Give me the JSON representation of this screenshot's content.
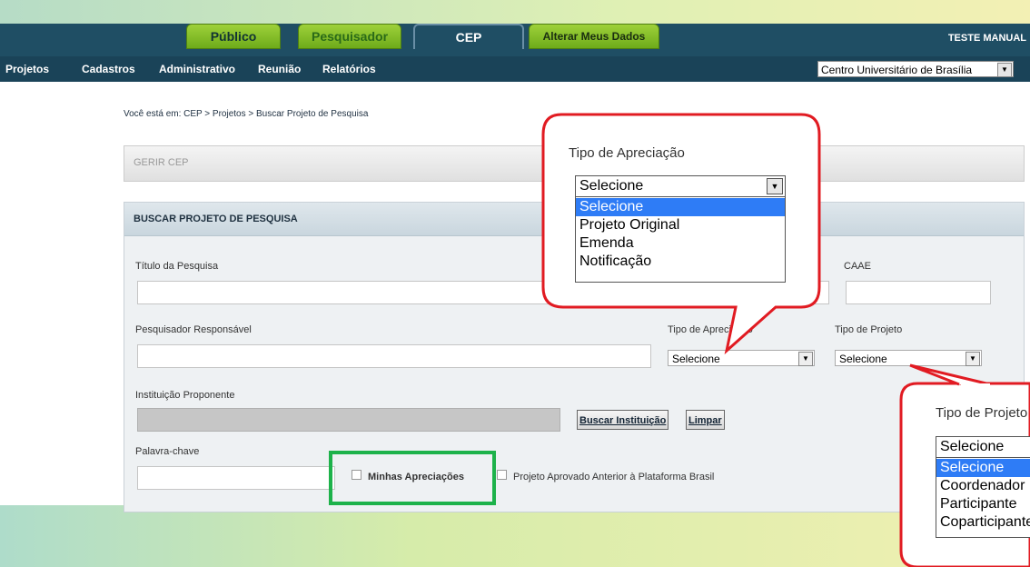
{
  "tabs": [
    {
      "label": "Público",
      "active": false
    },
    {
      "label": "Pesquisador",
      "active": false
    },
    {
      "label": "CEP",
      "active": true
    },
    {
      "label": "Alterar Meus Dados",
      "active": false
    }
  ],
  "user": {
    "name": "TESTE MANUAL"
  },
  "menu": [
    "Projetos",
    "Cadastros",
    "Administrativo",
    "Reunião",
    "Relatórios"
  ],
  "institution_select": {
    "value": "Centro Universitário de Brasília"
  },
  "breadcrumb": "Você está em: CEP > Projetos > Buscar Projeto de Pesquisa",
  "gerir_title": "GERIR CEP",
  "panel_title": "BUSCAR PROJETO DE PESQUISA",
  "form": {
    "titulo_label": "Título da Pesquisa",
    "caae_label": "CAAE",
    "pesquisador_label": "Pesquisador Responsável",
    "tipo_apreciacao_label": "Tipo de Apreciação",
    "tipo_apreciacao_value": "Selecione",
    "tipo_projeto_label": "Tipo de Projeto",
    "tipo_projeto_value": "Selecione",
    "instituicao_label": "Instituição Proponente",
    "buscar_instituicao": "Buscar Instituição",
    "limpar": "Limpar",
    "palavra_label": "Palavra-chave",
    "minhas_apreciacoes": "Minhas Apreciações",
    "projeto_aprovado": "Projeto Aprovado Anterior à Plataforma Brasil"
  },
  "callout_apreciacao": {
    "title": "Tipo de Apreciação",
    "selected": "Selecione",
    "options": [
      "Selecione",
      "Projeto Original",
      "Emenda",
      "Notificação"
    ],
    "highlighted_index": 0
  },
  "callout_projeto": {
    "title": "Tipo de Projeto",
    "selected": "Selecione",
    "options": [
      "Selecione",
      "Coordenador",
      "Participante",
      "Coparticipante"
    ],
    "highlighted_index": 0
  },
  "colors": {
    "accent_green": "#7dbb22",
    "nav_blue": "#1f4e64",
    "callout_red": "#e11b22",
    "highlight_box": "#1db24a"
  }
}
